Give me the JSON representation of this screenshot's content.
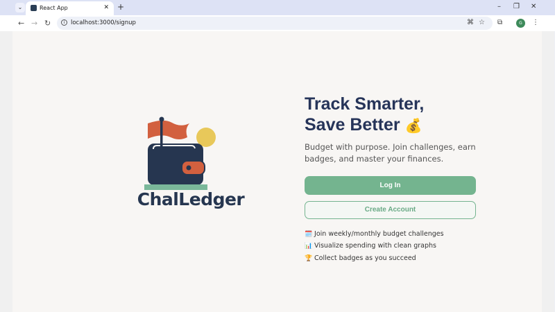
{
  "browser": {
    "tab_title": "React App",
    "url": "localhost:3000/signup",
    "profile_initials": "G"
  },
  "brand": {
    "name": "ChalLedger",
    "colors": {
      "navy": "#263650",
      "flag": "#d2603f",
      "sun": "#e8c85a",
      "green": "#74b48f"
    }
  },
  "hero": {
    "title_line1": "Track Smarter,",
    "title_line2": "Save Better",
    "title_emoji": "💰",
    "description": "Budget with purpose. Join challenges, earn badges, and master your finances."
  },
  "actions": {
    "login_label": "Log In",
    "create_label": "Create Account"
  },
  "features": [
    {
      "icon": "🗓️",
      "text": "Join weekly/monthly budget challenges"
    },
    {
      "icon": "📊",
      "text": "Visualize spending with clean graphs"
    },
    {
      "icon": "🏆",
      "text": "Collect badges as you succeed"
    }
  ]
}
